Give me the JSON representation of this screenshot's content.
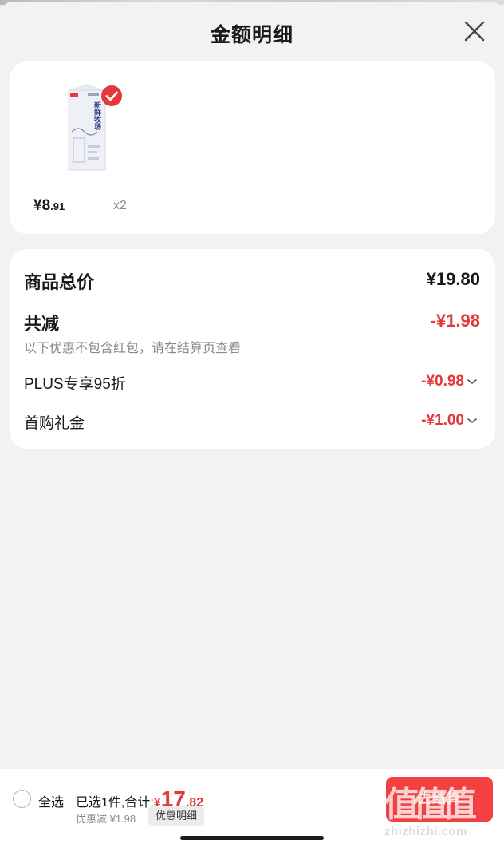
{
  "header": {
    "title": "金额明细"
  },
  "product": {
    "price_int": "¥8",
    "price_dec": ".91",
    "quantity": "x2",
    "selected": true,
    "package_text": "新鲜牧场"
  },
  "price_detail": {
    "subtotal_label": "商品总价",
    "subtotal_value": "¥19.80",
    "discount_label": "共减",
    "discount_value": "-¥1.98",
    "discount_note": "以下优惠不包含红包，请在结算页查看",
    "items": [
      {
        "label": "PLUS专享95折",
        "value": "-¥0.98"
      },
      {
        "label": "首购礼金",
        "value": "-¥1.00"
      }
    ]
  },
  "bottom_bar": {
    "select_all_label": "全选",
    "summary_prefix": "已选1件,合计:",
    "total_currency": "¥",
    "total_int": "17",
    "total_dec": ".82",
    "saved_text": "优惠减:¥1.98",
    "detail_button_label": "优惠明细",
    "checkout_label": "去结算"
  },
  "watermark": {
    "logo": "值值值",
    "url": "zhizhizhi.com"
  },
  "colors": {
    "accent_red": "#e4393c",
    "checkout_red": "#f23030",
    "background": "#f2f2f2"
  }
}
